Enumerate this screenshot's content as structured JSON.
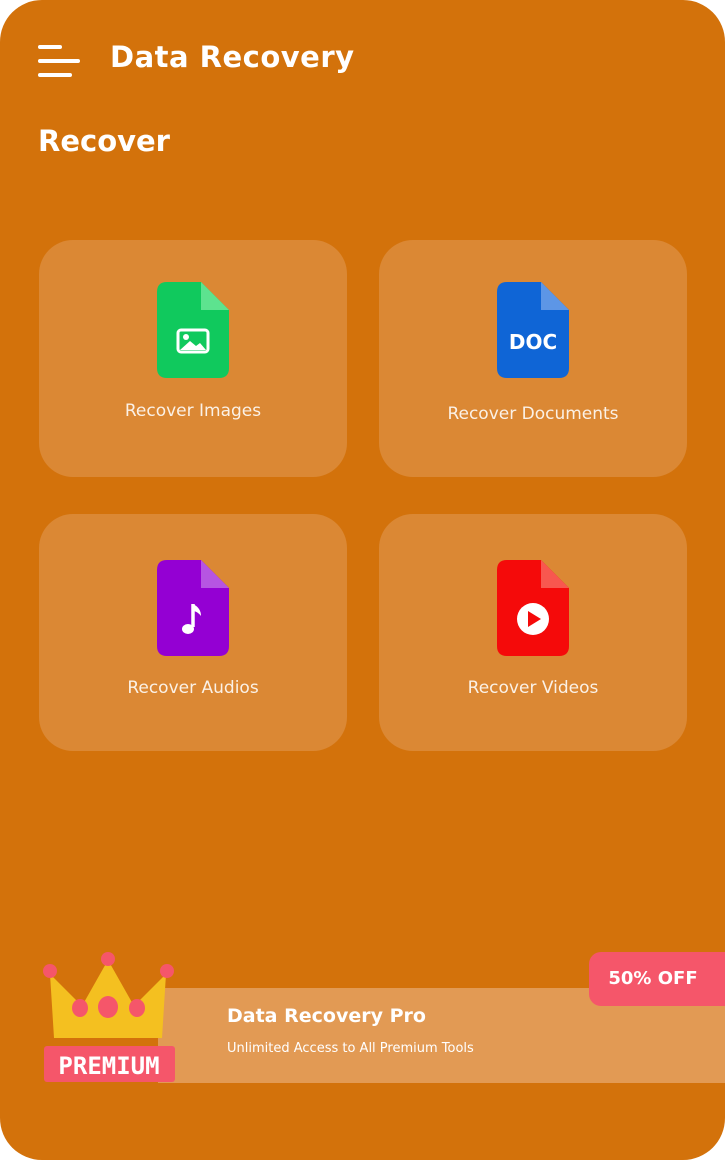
{
  "header": {
    "title": "Data Recovery",
    "menu_icon": "hamburger-menu-icon"
  },
  "section": {
    "title": "Recover"
  },
  "cards": [
    {
      "label": "Recover Images",
      "icon": "image-file-icon",
      "color": "#10c95d",
      "fold_color": "#5de38f"
    },
    {
      "label": "Recover Documents",
      "icon": "doc-file-icon",
      "icon_text": "DOC",
      "color": "#0f65d6",
      "fold_color": "#5d96e6"
    },
    {
      "label": "Recover Audios",
      "icon": "audio-file-icon",
      "color": "#9400d3",
      "fold_color": "#b655e2"
    },
    {
      "label": "Recover Videos",
      "icon": "video-file-icon",
      "color": "#f50a0a",
      "fold_color": "#f8574f"
    }
  ],
  "premium": {
    "title": "Data Recovery Pro",
    "subtitle": "Unlimited Access to All Premium Tools",
    "badge_text": "PREMIUM",
    "discount": "50% OFF",
    "crown_icon": "crown-icon"
  },
  "colors": {
    "background": "#d3720b",
    "card": "#db8834",
    "premium_band": "#e29a54",
    "discount": "#f5566a",
    "crown": "#f4c020",
    "premium_badge": "#f5566a"
  }
}
